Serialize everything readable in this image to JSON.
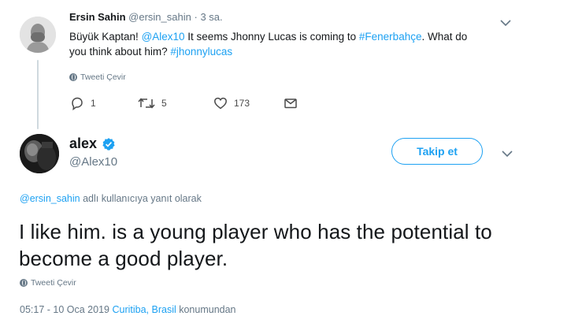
{
  "parent_tweet": {
    "name": "Ersin Sahin",
    "handle": "@ersin_sahin",
    "separator": "·",
    "time": "3 sa.",
    "text_parts": {
      "t1": "Büyük Kaptan! ",
      "mention": "@Alex10",
      "t2": " It seems Jhonny Lucas is coming to ",
      "hashtag1": "#Fenerbahçe",
      "t3": ". What do you think about him? ",
      "hashtag2": "#jhonnylucas"
    },
    "translate_label": "Tweeti Çevir",
    "actions": {
      "reply_count": "1",
      "retweet_count": "5",
      "like_count": "173"
    },
    "avatar_icon": "avatar-bald-man-icon"
  },
  "main_tweet": {
    "name": "alex",
    "handle": "@Alex10",
    "follow_label": "Takip et",
    "reply_to": {
      "mention": "@ersin_sahin",
      "suffix": " adlı kullanıcıya yanıt olarak"
    },
    "text": "I like him. is a young player who has the potential to become a good player.",
    "translate_label": "Tweeti Çevir",
    "meta": {
      "timestamp": "05:17 - 10 Oca 2019",
      "location": "Curitiba, Brasil",
      "location_suffix": "konumundan"
    },
    "avatar_icon": "avatar-alex-photo-icon"
  },
  "colors": {
    "link": "#1da1f2",
    "muted": "#657786",
    "text": "#14171a",
    "thread_line": "#cfd9de"
  }
}
